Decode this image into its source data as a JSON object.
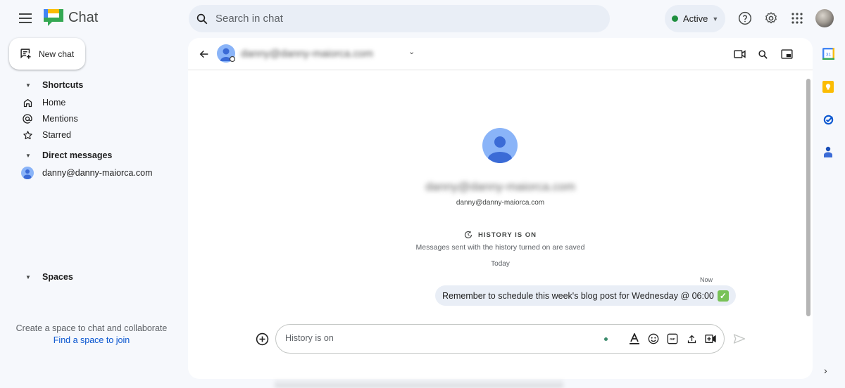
{
  "app": {
    "title": "Chat",
    "icons": {
      "menu": "hamburger-menu-icon",
      "logo": "google-chat-logo"
    }
  },
  "search": {
    "placeholder": "Search in chat",
    "icon": "search-icon"
  },
  "status": {
    "label": "Active",
    "color": "#1e8e3e"
  },
  "top_icons": [
    "help-icon",
    "settings-gear-icon",
    "apps-grid-icon",
    "account-avatar"
  ],
  "sidebar": {
    "new_chat_label": "New chat",
    "shortcuts": {
      "label": "Shortcuts",
      "items": [
        {
          "label": "Home",
          "icon": "home-icon"
        },
        {
          "label": "Mentions",
          "icon": "at-mention-icon"
        },
        {
          "label": "Starred",
          "icon": "star-icon"
        }
      ]
    },
    "direct_messages": {
      "label": "Direct messages",
      "items": [
        {
          "label": "danny@danny-maiorca.com",
          "icon": "user-avatar"
        }
      ]
    },
    "spaces": {
      "label": "Spaces",
      "empty_text": "Create a space to chat and collaborate",
      "find_link": "Find a space to join"
    }
  },
  "conversation": {
    "header": {
      "name_blurred": "danny@danny-maiorca.com",
      "icons": [
        "video-call-icon",
        "search-icon",
        "picture-in-picture-icon"
      ]
    },
    "intro": {
      "name_blurred": "danny@danny-maiorca.com",
      "email": "danny@danny-maiorca.com"
    },
    "history": {
      "title": "HISTORY IS ON",
      "subtitle": "Messages sent with the history turned on are saved"
    },
    "day_label": "Today",
    "messages": [
      {
        "time": "Now",
        "text": "Remember to schedule this week's blog post for Wednesday @ 06:00",
        "emoji": "✓"
      }
    ]
  },
  "composer": {
    "placeholder": "History is on",
    "icons": [
      "format-text-icon",
      "emoji-icon",
      "gif-icon",
      "upload-icon",
      "video-meeting-icon"
    ],
    "send_icon": "send-icon",
    "add_icon": "add-circle-icon"
  },
  "right_rail": {
    "icons": [
      "calendar-icon",
      "keep-icon",
      "tasks-icon",
      "contacts-icon"
    ],
    "calendar_day": "31",
    "expand_icon": "chevron-right-icon",
    "expand_glyph": "›"
  },
  "colors": {
    "background": "#f6f8fc",
    "search_bg": "#e9eef6",
    "accent_blue": "#0b57d0",
    "avatar_blue": "#8ab4f8"
  }
}
